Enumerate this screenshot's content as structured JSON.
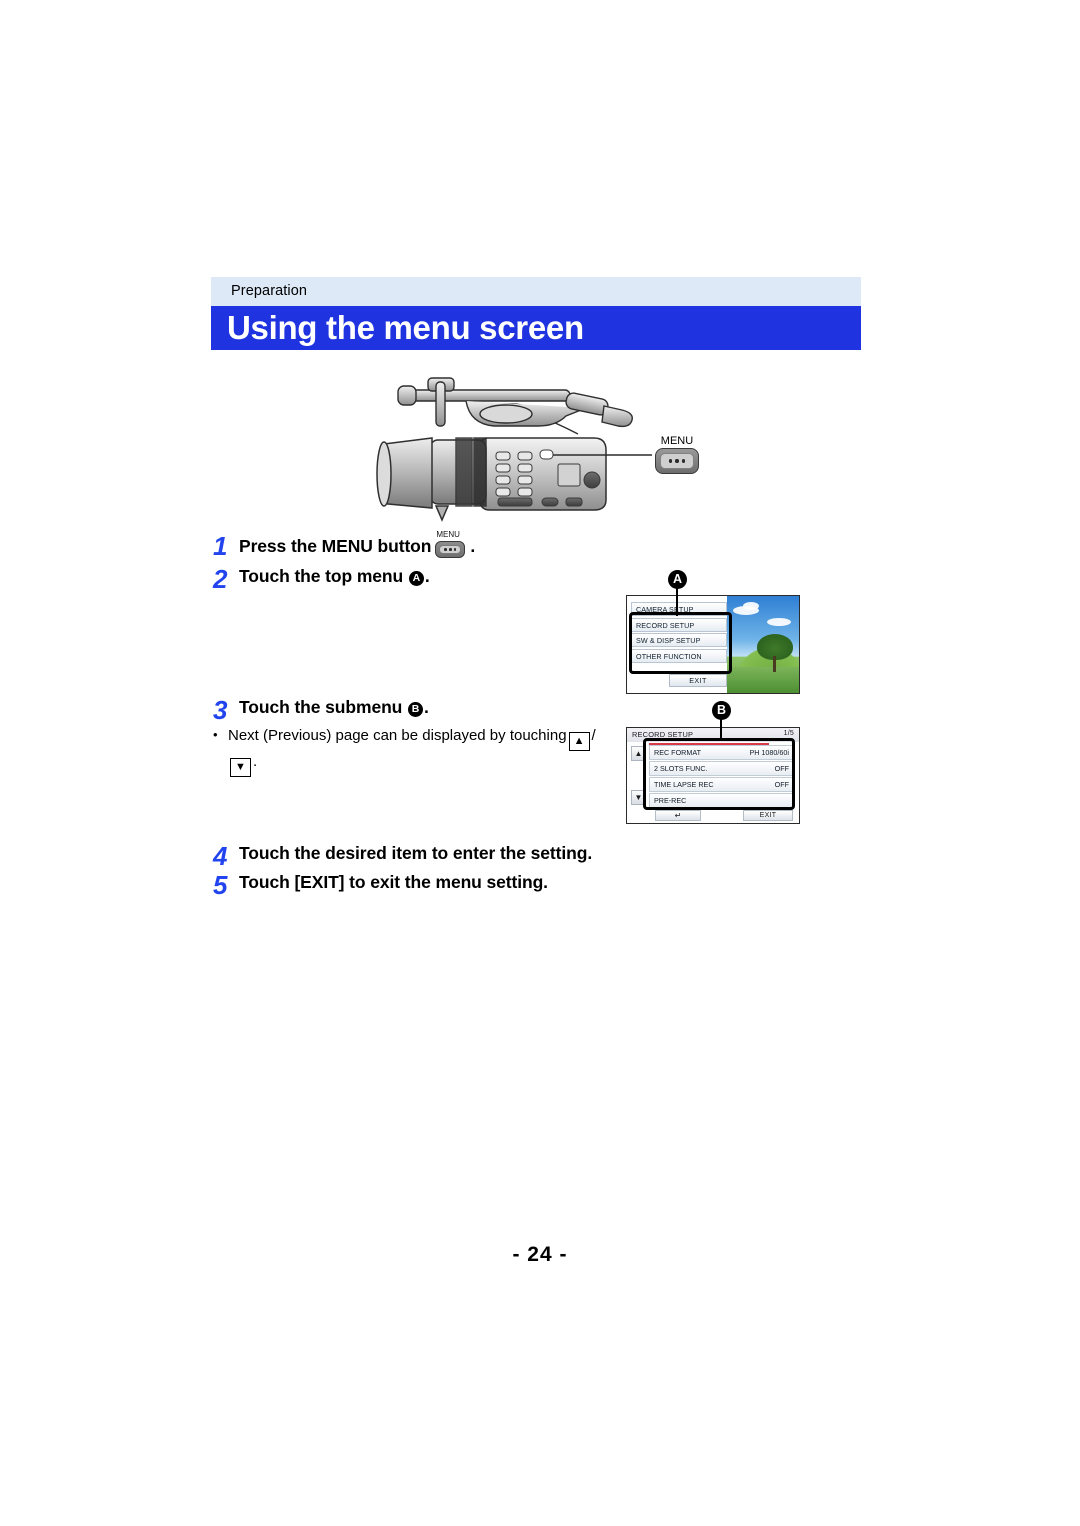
{
  "header": {
    "section": "Preparation",
    "title": "Using the menu screen"
  },
  "figure": {
    "camera_callout_label": "MENU",
    "camera_alt": "camcorder-illustration"
  },
  "steps": [
    {
      "num": "1",
      "text_before": "Press the MENU button",
      "icon": "menu-button-icon",
      "icon_label": "MENU",
      "text_after": "."
    },
    {
      "num": "2",
      "text_before": "Touch the top menu",
      "marker": "A",
      "text_after": "."
    },
    {
      "num": "3",
      "text_before": "Touch the submenu",
      "marker": "B",
      "text_after": "."
    },
    {
      "num": "4",
      "text_before": "Touch the desired item to enter the setting.",
      "marker": "",
      "text_after": ""
    },
    {
      "num": "5",
      "text_before": "Touch [EXIT] to exit the menu setting.",
      "marker": "",
      "text_after": ""
    }
  ],
  "note": {
    "bullet": "•",
    "text_before": "Next (Previous) page can be displayed by touching",
    "key_up": "▲",
    "separator": "/",
    "key_down": "▼",
    "text_after": "."
  },
  "top_menu_screen": {
    "marker": "A",
    "items": [
      "CAMERA SETUP",
      "RECORD SETUP",
      "SW & DISP SETUP",
      "OTHER FUNCTION"
    ],
    "exit_label": "EXIT"
  },
  "submenu_screen": {
    "marker": "B",
    "title": "RECORD SETUP",
    "title_right": "1/5",
    "scroll_up": "▲",
    "scroll_down": "▼",
    "rows": [
      {
        "label": "REC FORMAT",
        "value": "PH 1080/60i"
      },
      {
        "label": "2 SLOTS FUNC.",
        "value": "OFF"
      },
      {
        "label": "TIME LAPSE REC",
        "value": "OFF"
      },
      {
        "label": "PRE-REC",
        "value": ""
      }
    ],
    "return_label": "↵",
    "exit_label": "EXIT"
  },
  "footer": {
    "page_number": "- 24 -"
  },
  "colors": {
    "title_bar": "#1f33e0",
    "section_band": "#dde9f7",
    "step_number": "#2244ee",
    "accent_red": "#d93a4a"
  }
}
